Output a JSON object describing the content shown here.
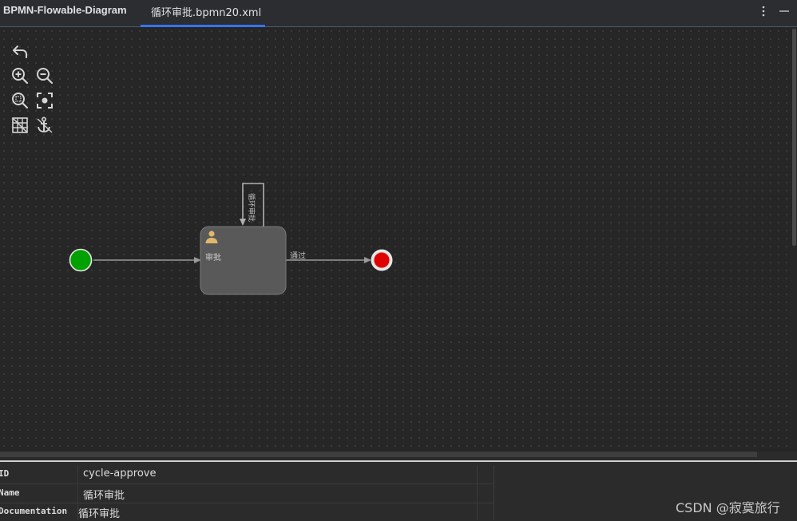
{
  "header": {
    "app_title": "BPMN-Flowable-Diagram",
    "active_tab": "循环审批.bpmn20.xml",
    "accent_color": "#3574f0"
  },
  "toolbar": {
    "tools": [
      {
        "name": "undo-icon"
      },
      {
        "name": "zoom-in-icon"
      },
      {
        "name": "zoom-out-icon"
      },
      {
        "name": "zoom-reset-icon"
      },
      {
        "name": "center-focus-icon"
      },
      {
        "name": "grid-icon"
      },
      {
        "name": "anchor-icon"
      }
    ]
  },
  "diagram": {
    "start_event_color": "#00a000",
    "end_event_color": "#e00000",
    "task_label": "审批",
    "task_icon": "user-icon",
    "loop_flow_label": "循环审批",
    "pass_flow_label": "通过"
  },
  "properties": {
    "rows": [
      {
        "key": "ID",
        "value": "cycle-approve"
      },
      {
        "key": "Name",
        "value": "循环审批"
      },
      {
        "key": "Documentation",
        "value": "循环审批"
      }
    ]
  },
  "watermark": "CSDN @寂寞旅行"
}
